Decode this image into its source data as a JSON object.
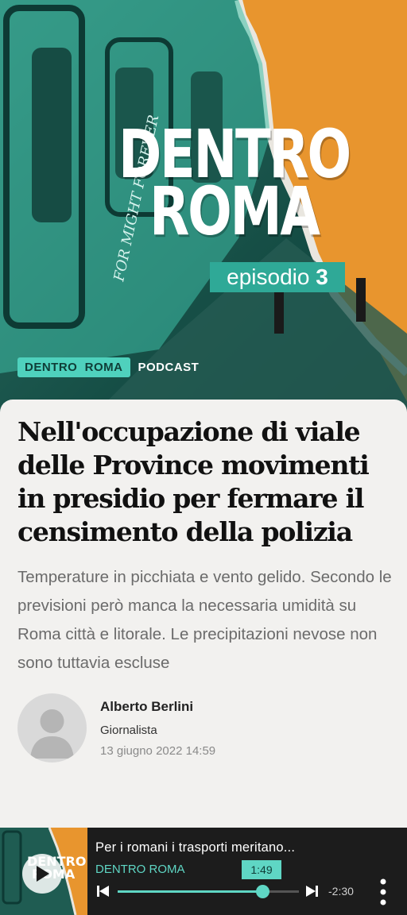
{
  "hero": {
    "title_line1": "DENTRO",
    "title_line2": "ROMA",
    "episode_label": "episodio",
    "episode_number": "3",
    "tag_show": "DENTRO  ROMA",
    "tag_type": "PODCAST",
    "graffiti_text": "FOR MIGHT FOREVER"
  },
  "article": {
    "headline": "Nell'occupazione di viale delle Province movimenti in presidio per fermare il censimento della polizia",
    "summary": "Temperature in picchiata e vento gelido. Secondo le previsioni però manca la necessaria umidità su Roma città e litorale. Le precipitazioni nevose non sono tuttavia escluse",
    "author": {
      "name": "Alberto Berlini",
      "role": "Giornalista",
      "date": "13 giugno 2022 14:59"
    }
  },
  "player": {
    "title": "Per i romani i trasporti meritano...",
    "show": "DENTRO ROMA",
    "current_time": "1:49",
    "remaining_time": "-2:30",
    "progress": 0.8,
    "thumb_title_line1": "DENTRO",
    "thumb_title_line2": "ROMA"
  },
  "colors": {
    "accent": "#5fd6c4",
    "hero_orange": "#e8952e",
    "hero_teal": "#2fa997"
  }
}
